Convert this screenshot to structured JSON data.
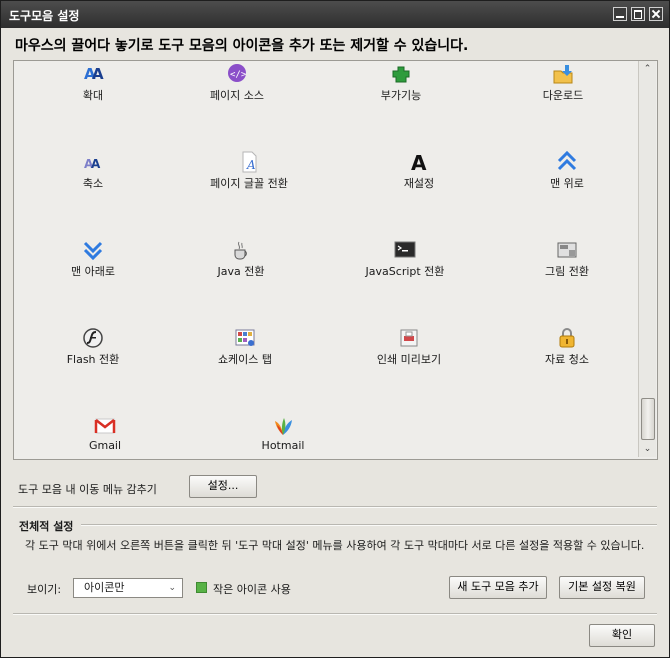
{
  "window": {
    "title": "도구모음 설정"
  },
  "instruction": "마우스의 끌어다 놓기로 도구 모음의 아이콘을 추가 또는 제거할 수 있습니다.",
  "palette": [
    {
      "label": "확대",
      "icon": "zoom-in-icon"
    },
    {
      "label": "페이지 소스",
      "icon": "page-source-icon"
    },
    {
      "label": "부가기능",
      "icon": "addons-icon"
    },
    {
      "label": "다운로드",
      "icon": "downloads-icon"
    },
    {
      "label": "축소",
      "icon": "zoom-out-icon"
    },
    {
      "label": "페이지 글꼴 전환",
      "icon": "page-font-icon"
    },
    {
      "label": "재설정",
      "icon": "reset-icon"
    },
    {
      "label": "맨 위로",
      "icon": "scroll-top-icon"
    },
    {
      "label": "맨 아래로",
      "icon": "scroll-bottom-icon"
    },
    {
      "label": "Java 전환",
      "icon": "java-icon"
    },
    {
      "label": "JavaScript 전환",
      "icon": "javascript-icon"
    },
    {
      "label": "그림 전환",
      "icon": "images-icon"
    },
    {
      "label": "Flash 전환",
      "icon": "flash-icon"
    },
    {
      "label": "쇼케이스 탭",
      "icon": "showcase-icon"
    },
    {
      "label": "인쇄 미리보기",
      "icon": "print-preview-icon"
    },
    {
      "label": "자료 청소",
      "icon": "clear-data-icon"
    },
    {
      "label": "Gmail",
      "icon": "gmail-icon"
    },
    {
      "label": "Hotmail",
      "icon": "hotmail-icon"
    }
  ],
  "hide_menu": {
    "label": "도구 모음 내 이동 메뉴 감추기",
    "button": "설정..."
  },
  "global": {
    "title": "전체적 설정",
    "description": "각 도구 막대 위에서 오른쪽 버튼을 클릭한 뒤 '도구 막대 설정' 메뉴를 사용하여 각 도구 막대마다 서로 다른 설정을 적용할 수 있습니다.",
    "show_label": "보이기:",
    "show_value": "아이콘만",
    "small_icons_label": "작은 아이콘 사용",
    "small_icons_checked": true,
    "add_toolbar_button": "새 도구 모음 추가",
    "restore_button": "기본 설정 복원"
  },
  "ok_button": "확인"
}
